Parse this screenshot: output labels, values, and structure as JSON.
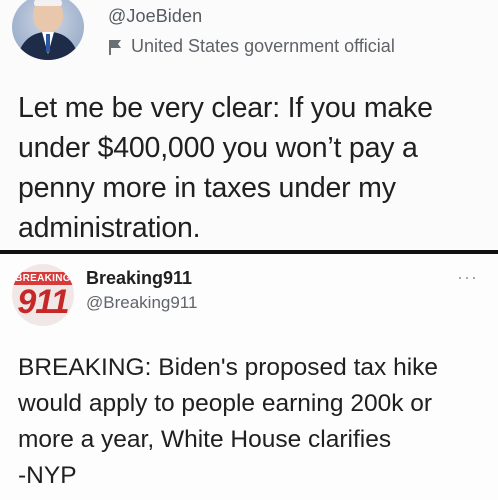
{
  "tweet_top": {
    "handle": "@JoeBiden",
    "label": "United States government official",
    "text_lines": [
      "Let me be very clear: If you make",
      "under $400,000 you won’t pay a",
      "penny more in taxes under my",
      "administration."
    ],
    "label_icon": "flag-icon"
  },
  "tweet_bottom": {
    "avatar_band": "BREAKING",
    "avatar_number": "911",
    "name": "Breaking911",
    "handle": "@Breaking911",
    "more": "···",
    "text_lines": [
      "BREAKING: Biden's proposed tax hike",
      "would apply to people earning 200k or",
      "more a year, White House clarifies",
      "-NYP"
    ]
  },
  "colors": {
    "divider": "#111111",
    "brand_red": "#d63a3a",
    "text": "#202020",
    "muted": "#5f6368"
  }
}
